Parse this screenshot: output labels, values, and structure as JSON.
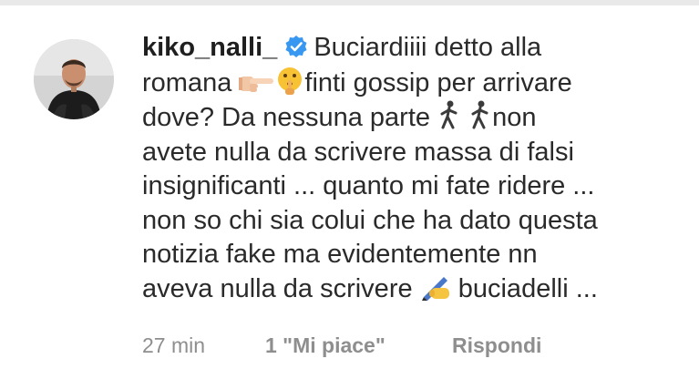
{
  "comment": {
    "username": "kiko_nalli_",
    "verified_icon": "verified-badge-icon",
    "lines": [
      "Buciardiiii detto alla",
      "romana",
      "finti gossip per arrivare",
      "dove? Da nessuna parte",
      "non",
      "avete nulla da scrivere massa di  falsi",
      "insignificanti ... quanto mi fate ridere ...",
      "non so chi sia colui che ha dato questa",
      "notizia fake ma evidentemente nn",
      "aveva nulla da scrivere",
      "buciadelli ..."
    ],
    "emojis": [
      "pointing-hand-emoji",
      "shushing-face-emoji",
      "person-walking-emoji",
      "person-walking-emoji",
      "writing-hand-emoji"
    ]
  },
  "meta": {
    "time": "27 min",
    "likes": "1 \"Mi piace\"",
    "reply": "Rispondi"
  },
  "colors": {
    "text": "#2a2a2a",
    "meta": "#8e8e8e",
    "verified": "#3897f0"
  }
}
